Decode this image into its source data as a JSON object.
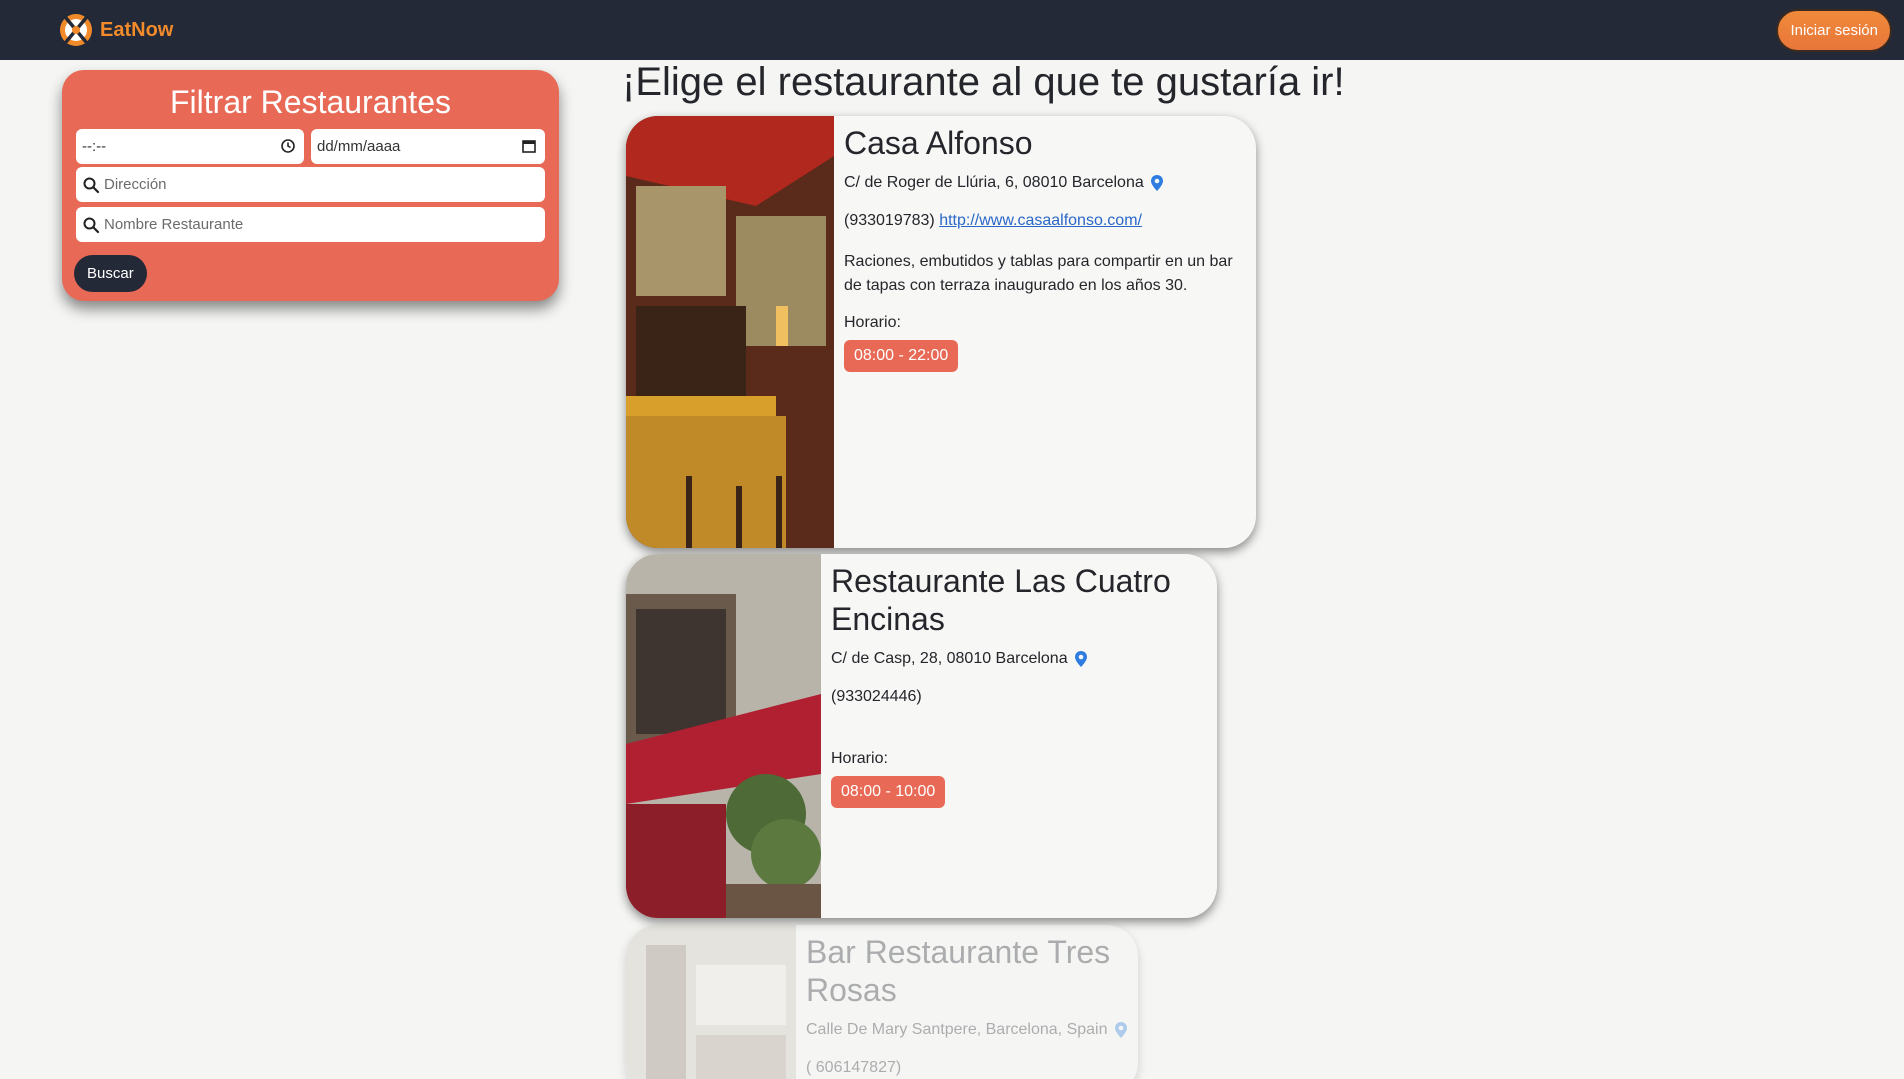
{
  "navbar": {
    "brand": "EatNow",
    "login_label": "Iniciar sesión",
    "accent": "#f08a2b",
    "background": "#242938"
  },
  "filter": {
    "title": "Filtrar Restaurantes",
    "time_value": "--:--",
    "date_value": "dd/mm/aaaa",
    "address_placeholder": "Dirección",
    "name_placeholder": "Nombre Restaurante",
    "search_label": "Buscar",
    "color": "#e86a56"
  },
  "main": {
    "title": "¡Elige el restaurante al que te gustaría ir!"
  },
  "restaurants": [
    {
      "name": "Casa Alfonso",
      "address": "C/ de Roger de Llúria, 6, 08010 Barcelona",
      "phone": "(933019783)",
      "url": "http://www.casaalfonso.com/",
      "description": "Raciones, embutidos y tablas para compartir en un bar de tapas con terraza inaugurado en los años 30.",
      "hours_label": "Horario:",
      "hours": "08:00 - 22:00"
    },
    {
      "name": "Restaurante Las Cuatro Encinas",
      "address": "C/ de Casp, 28, 08010 Barcelona",
      "phone": "(933024446)",
      "hours_label": "Horario:",
      "hours": "08:00 - 10:00"
    },
    {
      "name": "Bar Restaurante Tres Rosas",
      "address": "Calle De Mary Santpere, Barcelona, Spain",
      "phone": "( 606147827)"
    }
  ]
}
